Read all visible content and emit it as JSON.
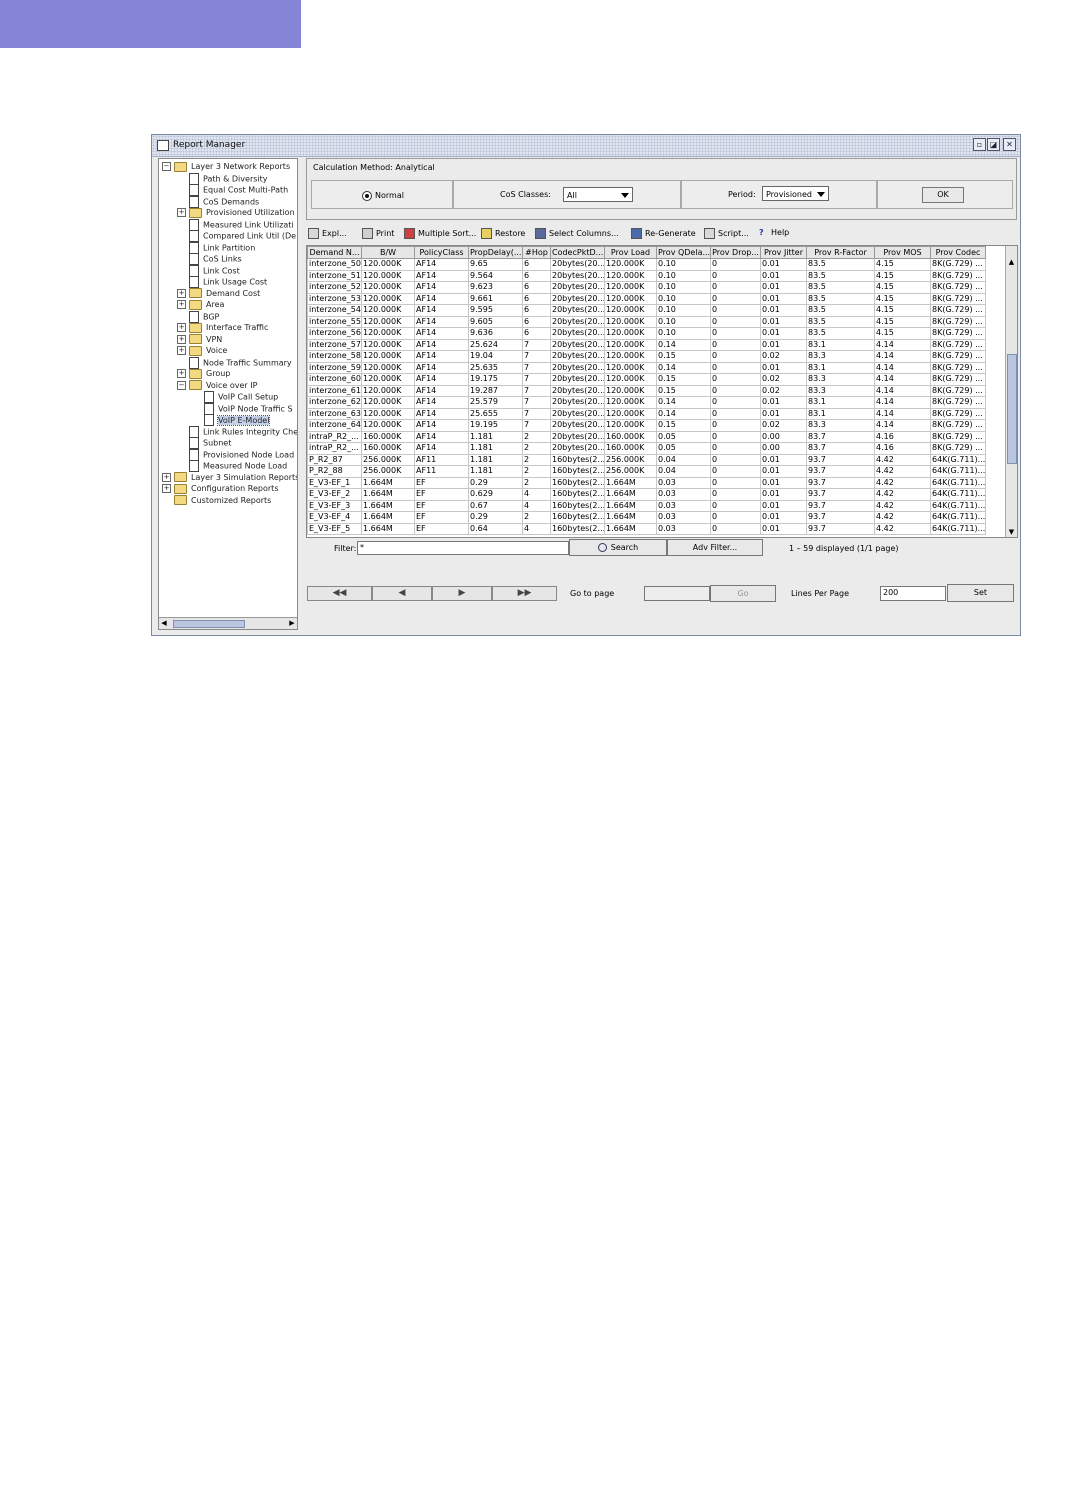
{
  "window": {
    "title": "Report Manager"
  },
  "tree": [
    {
      "label": "Layer 3 Network Reports",
      "toggle": "−",
      "icon": "folder",
      "indent": 0
    },
    {
      "label": "Path & Diversity",
      "toggle": "",
      "icon": "doc",
      "indent": 1
    },
    {
      "label": "Equal Cost Multi-Path",
      "toggle": "",
      "icon": "doc",
      "indent": 1
    },
    {
      "label": "CoS Demands",
      "toggle": "",
      "icon": "doc",
      "indent": 1
    },
    {
      "label": "Provisioned Utilization",
      "toggle": "+",
      "icon": "folder",
      "indent": 1
    },
    {
      "label": "Measured Link Utilizati",
      "toggle": "",
      "icon": "doc",
      "indent": 1
    },
    {
      "label": "Compared Link Util (De",
      "toggle": "",
      "icon": "doc",
      "indent": 1
    },
    {
      "label": "Link Partition",
      "toggle": "",
      "icon": "doc",
      "indent": 1
    },
    {
      "label": "CoS Links",
      "toggle": "",
      "icon": "doc",
      "indent": 1
    },
    {
      "label": "Link Cost",
      "toggle": "",
      "icon": "doc",
      "indent": 1
    },
    {
      "label": "Link Usage Cost",
      "toggle": "",
      "icon": "doc",
      "indent": 1
    },
    {
      "label": "Demand Cost",
      "toggle": "+",
      "icon": "folder",
      "indent": 1
    },
    {
      "label": "Area",
      "toggle": "+",
      "icon": "folder",
      "indent": 1
    },
    {
      "label": "BGP",
      "toggle": "",
      "icon": "doc",
      "indent": 1
    },
    {
      "label": "Interface Traffic",
      "toggle": "+",
      "icon": "folder",
      "indent": 1
    },
    {
      "label": "VPN",
      "toggle": "+",
      "icon": "folder",
      "indent": 1
    },
    {
      "label": "Voice",
      "toggle": "+",
      "icon": "folder",
      "indent": 1
    },
    {
      "label": "Node Traffic Summary",
      "toggle": "",
      "icon": "doc",
      "indent": 1
    },
    {
      "label": "Group",
      "toggle": "+",
      "icon": "folder",
      "indent": 1
    },
    {
      "label": "Voice over IP",
      "toggle": "−",
      "icon": "folder",
      "indent": 1
    },
    {
      "label": "VoIP Call Setup",
      "toggle": "",
      "icon": "doc",
      "indent": 2
    },
    {
      "label": "VoIP Node Traffic S",
      "toggle": "",
      "icon": "doc",
      "indent": 2
    },
    {
      "label": "VoIP E-Model",
      "toggle": "",
      "icon": "doc",
      "indent": 2,
      "selected": true
    },
    {
      "label": "Link Rules Integrity Che",
      "toggle": "",
      "icon": "doc",
      "indent": 1
    },
    {
      "label": "Subnet",
      "toggle": "",
      "icon": "doc",
      "indent": 1
    },
    {
      "label": "Provisioned Node Load",
      "toggle": "",
      "icon": "doc",
      "indent": 1
    },
    {
      "label": "Measured Node Load",
      "toggle": "",
      "icon": "doc",
      "indent": 1
    },
    {
      "label": "Layer 3 Simulation Reports",
      "toggle": "+",
      "icon": "folder",
      "indent": 0
    },
    {
      "label": "Configuration Reports",
      "toggle": "+",
      "icon": "folder",
      "indent": 0
    },
    {
      "label": "Customized Reports",
      "toggle": "",
      "icon": "folder",
      "indent": 0
    }
  ],
  "calc": {
    "legend": "Calculation Method: Analytical",
    "normal_label": "Normal",
    "cos_label": "CoS Classes:",
    "cos_value": "All",
    "period_label": "Period:",
    "period_value": "Provisioned",
    "ok_label": "OK"
  },
  "toolbar": [
    {
      "label": "Expl...",
      "icon": "explorer-icon"
    },
    {
      "label": "Print",
      "icon": "printer-icon"
    },
    {
      "label": "Multiple Sort...",
      "icon": "sort-icon"
    },
    {
      "label": "Restore",
      "icon": "restore-icon"
    },
    {
      "label": "Select Columns...",
      "icon": "columns-icon"
    },
    {
      "label": "Re-Generate",
      "icon": "regenerate-icon"
    },
    {
      "label": "Script...",
      "icon": "script-icon"
    },
    {
      "label": "Help",
      "icon": "help-icon"
    }
  ],
  "table": {
    "columns": [
      "Demand N...",
      "B/W",
      "PolicyClass",
      "PropDelay(...",
      "#Hop",
      "CodecPktD...",
      "Prov Load",
      "Prov QDela...",
      "Prov Drop...",
      "Prov Jitter",
      "Prov R-Factor",
      "Prov MOS",
      "Prov Codec"
    ],
    "rows": [
      [
        "interzone_50",
        "120.000K",
        "AF14",
        "9.65",
        "6",
        "20bytes(20...",
        "120.000K",
        "0.10",
        "0",
        "0.01",
        "83.5",
        "4.15",
        "8K(G.729) ..."
      ],
      [
        "interzone_51",
        "120.000K",
        "AF14",
        "9.564",
        "6",
        "20bytes(20...",
        "120.000K",
        "0.10",
        "0",
        "0.01",
        "83.5",
        "4.15",
        "8K(G.729) ..."
      ],
      [
        "interzone_52",
        "120.000K",
        "AF14",
        "9.623",
        "6",
        "20bytes(20...",
        "120.000K",
        "0.10",
        "0",
        "0.01",
        "83.5",
        "4.15",
        "8K(G.729) ..."
      ],
      [
        "interzone_53",
        "120.000K",
        "AF14",
        "9.661",
        "6",
        "20bytes(20...",
        "120.000K",
        "0.10",
        "0",
        "0.01",
        "83.5",
        "4.15",
        "8K(G.729) ..."
      ],
      [
        "interzone_54",
        "120.000K",
        "AF14",
        "9.595",
        "6",
        "20bytes(20...",
        "120.000K",
        "0.10",
        "0",
        "0.01",
        "83.5",
        "4.15",
        "8K(G.729) ..."
      ],
      [
        "interzone_55",
        "120.000K",
        "AF14",
        "9.605",
        "6",
        "20bytes(20...",
        "120.000K",
        "0.10",
        "0",
        "0.01",
        "83.5",
        "4.15",
        "8K(G.729) ..."
      ],
      [
        "interzone_56",
        "120.000K",
        "AF14",
        "9.636",
        "6",
        "20bytes(20...",
        "120.000K",
        "0.10",
        "0",
        "0.01",
        "83.5",
        "4.15",
        "8K(G.729) ..."
      ],
      [
        "interzone_57",
        "120.000K",
        "AF14",
        "25.624",
        "7",
        "20bytes(20...",
        "120.000K",
        "0.14",
        "0",
        "0.01",
        "83.1",
        "4.14",
        "8K(G.729) ..."
      ],
      [
        "interzone_58",
        "120.000K",
        "AF14",
        "19.04",
        "7",
        "20bytes(20...",
        "120.000K",
        "0.15",
        "0",
        "0.02",
        "83.3",
        "4.14",
        "8K(G.729) ..."
      ],
      [
        "interzone_59",
        "120.000K",
        "AF14",
        "25.635",
        "7",
        "20bytes(20...",
        "120.000K",
        "0.14",
        "0",
        "0.01",
        "83.1",
        "4.14",
        "8K(G.729) ..."
      ],
      [
        "interzone_60",
        "120.000K",
        "AF14",
        "19.175",
        "7",
        "20bytes(20...",
        "120.000K",
        "0.15",
        "0",
        "0.02",
        "83.3",
        "4.14",
        "8K(G.729) ..."
      ],
      [
        "interzone_61",
        "120.000K",
        "AF14",
        "19.287",
        "7",
        "20bytes(20...",
        "120.000K",
        "0.15",
        "0",
        "0.02",
        "83.3",
        "4.14",
        "8K(G.729) ..."
      ],
      [
        "interzone_62",
        "120.000K",
        "AF14",
        "25.579",
        "7",
        "20bytes(20...",
        "120.000K",
        "0.14",
        "0",
        "0.01",
        "83.1",
        "4.14",
        "8K(G.729) ..."
      ],
      [
        "interzone_63",
        "120.000K",
        "AF14",
        "25.655",
        "7",
        "20bytes(20...",
        "120.000K",
        "0.14",
        "0",
        "0.01",
        "83.1",
        "4.14",
        "8K(G.729) ..."
      ],
      [
        "interzone_64",
        "120.000K",
        "AF14",
        "19.195",
        "7",
        "20bytes(20...",
        "120.000K",
        "0.15",
        "0",
        "0.02",
        "83.3",
        "4.14",
        "8K(G.729) ..."
      ],
      [
        "intraP_R2_...",
        "160.000K",
        "AF14",
        "1.181",
        "2",
        "20bytes(20...",
        "160.000K",
        "0.05",
        "0",
        "0.00",
        "83.7",
        "4.16",
        "8K(G.729) ..."
      ],
      [
        "intraP_R2_...",
        "160.000K",
        "AF14",
        "1.181",
        "2",
        "20bytes(20...",
        "160.000K",
        "0.05",
        "0",
        "0.00",
        "83.7",
        "4.16",
        "8K(G.729) ..."
      ],
      [
        "P_R2_87",
        "256.000K",
        "AF11",
        "1.181",
        "2",
        "160bytes(2...",
        "256.000K",
        "0.04",
        "0",
        "0.01",
        "93.7",
        "4.42",
        "64K(G.711)..."
      ],
      [
        "P_R2_88",
        "256.000K",
        "AF11",
        "1.181",
        "2",
        "160bytes(2...",
        "256.000K",
        "0.04",
        "0",
        "0.01",
        "93.7",
        "4.42",
        "64K(G.711)..."
      ],
      [
        "E_V3-EF_1",
        "1.664M",
        "EF",
        "0.29",
        "2",
        "160bytes(2...",
        "1.664M",
        "0.03",
        "0",
        "0.01",
        "93.7",
        "4.42",
        "64K(G.711)..."
      ],
      [
        "E_V3-EF_2",
        "1.664M",
        "EF",
        "0.629",
        "4",
        "160bytes(2...",
        "1.664M",
        "0.03",
        "0",
        "0.01",
        "93.7",
        "4.42",
        "64K(G.711)..."
      ],
      [
        "E_V3-EF_3",
        "1.664M",
        "EF",
        "0.67",
        "4",
        "160bytes(2...",
        "1.664M",
        "0.03",
        "0",
        "0.01",
        "93.7",
        "4.42",
        "64K(G.711)..."
      ],
      [
        "E_V3-EF_4",
        "1.664M",
        "EF",
        "0.29",
        "2",
        "160bytes(2...",
        "1.664M",
        "0.03",
        "0",
        "0.01",
        "93.7",
        "4.42",
        "64K(G.711)..."
      ],
      [
        "E_V3-EF_5",
        "1.664M",
        "EF",
        "0.64",
        "4",
        "160bytes(2...",
        "1.664M",
        "0.03",
        "0",
        "0.01",
        "93.7",
        "4.42",
        "64K(G.711)..."
      ]
    ]
  },
  "filter": {
    "label": "Filter:",
    "value": "*",
    "search_label": "Search",
    "adv_label": "Adv Filter...",
    "status": "1 – 59 displayed (1/1 page)"
  },
  "paging": {
    "goto_label": "Go to page",
    "go_label": "Go",
    "lines_label": "Lines Per Page",
    "lines_value": "200",
    "set_label": "Set"
  }
}
